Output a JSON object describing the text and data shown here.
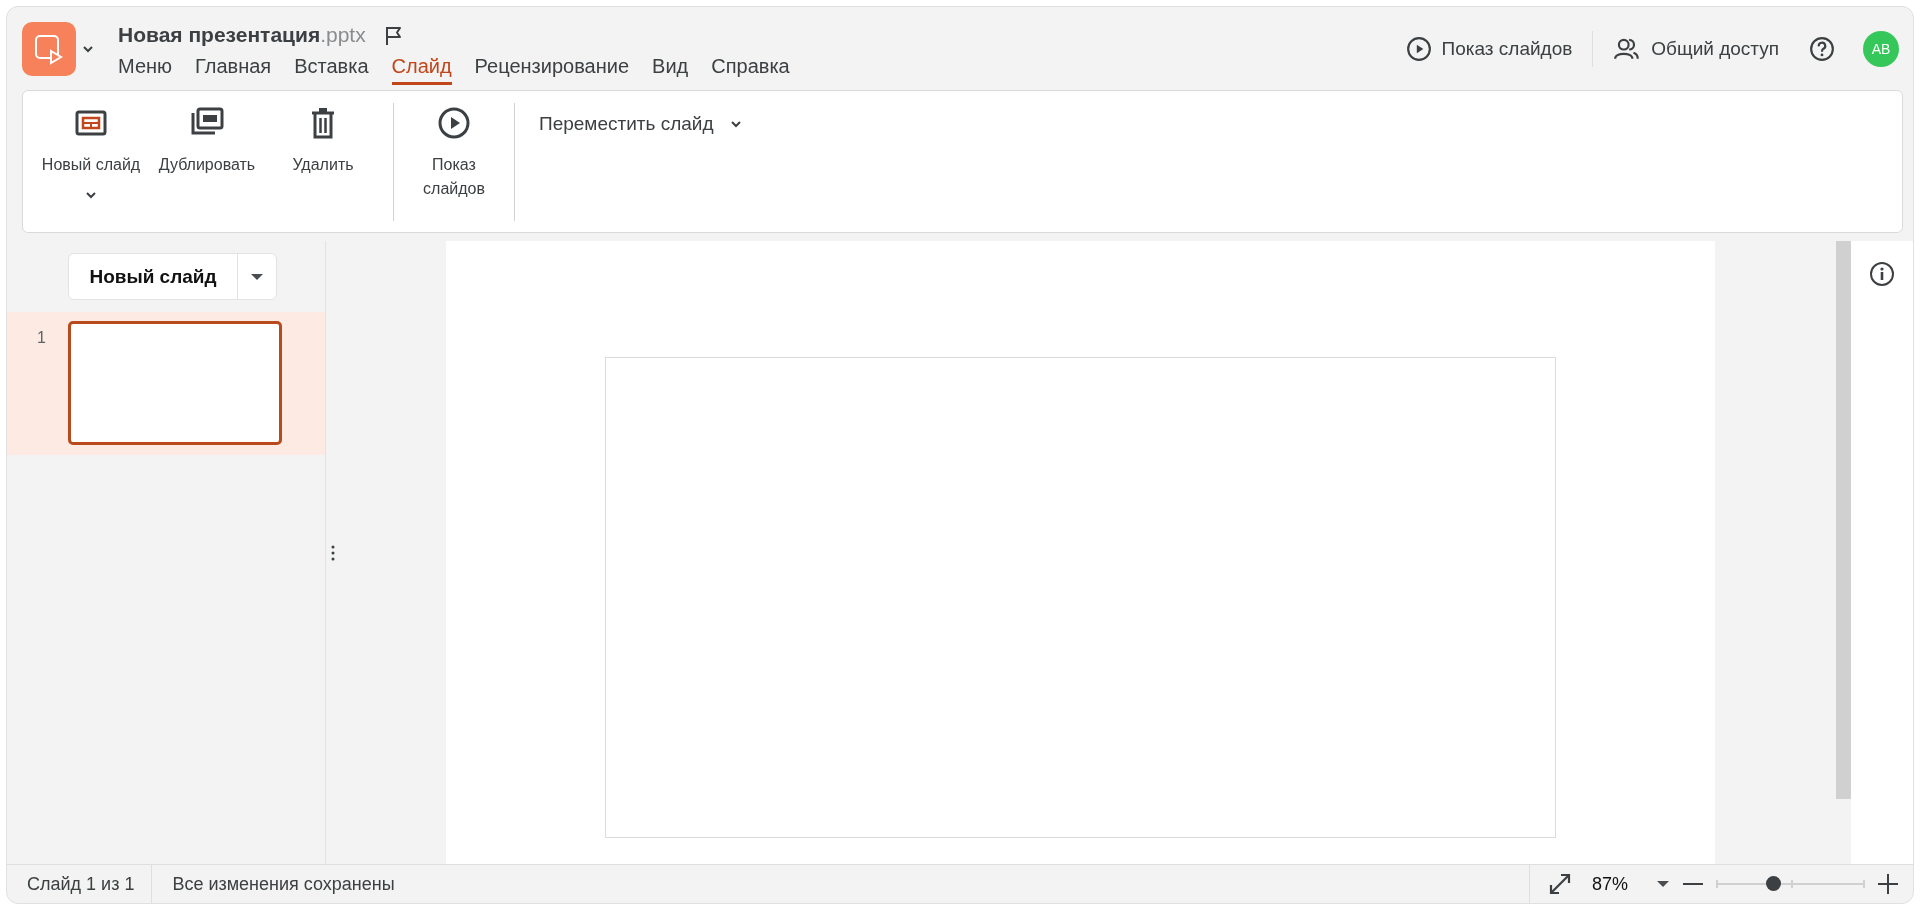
{
  "document": {
    "title": "Новая презентация",
    "extension": ".pptx"
  },
  "menu_tabs": [
    {
      "label": "Меню",
      "selected": false
    },
    {
      "label": "Главная",
      "selected": false
    },
    {
      "label": "Вставка",
      "selected": false
    },
    {
      "label": "Слайд",
      "selected": true
    },
    {
      "label": "Рецензирование",
      "selected": false
    },
    {
      "label": "Вид",
      "selected": false
    },
    {
      "label": "Справка",
      "selected": false
    }
  ],
  "header_actions": [
    {
      "kind": "slideshow",
      "label": "Показ слайдов"
    },
    {
      "kind": "share",
      "label": "Общий доступ"
    },
    {
      "kind": "help"
    }
  ],
  "avatar": {
    "initials": "AB"
  },
  "ribbon": {
    "groups": [
      {
        "items": [
          {
            "kind": "new-slide",
            "label": "Новый слайд",
            "has_menu": true
          },
          {
            "kind": "duplicate",
            "label": "Дублировать",
            "has_menu": false
          },
          {
            "kind": "delete",
            "label": "Удалить",
            "has_menu": false
          }
        ]
      },
      {
        "items": [
          {
            "kind": "slideshow",
            "label": "Показ слайдов",
            "has_menu": false
          }
        ]
      },
      {
        "items": [
          {
            "kind": "dropdown",
            "label": "Переместить слайд",
            "has_menu": true
          }
        ]
      }
    ]
  },
  "slides_panel": {
    "new_slide_button": "Новый слайд",
    "slides": [
      {
        "number": "1",
        "selected": true
      }
    ]
  },
  "status_bar": {
    "slide_counter": "Слайд 1 из 1",
    "save_status": "Все изменения сохранены",
    "zoom": {
      "value": "87%",
      "level": 0.38
    }
  }
}
